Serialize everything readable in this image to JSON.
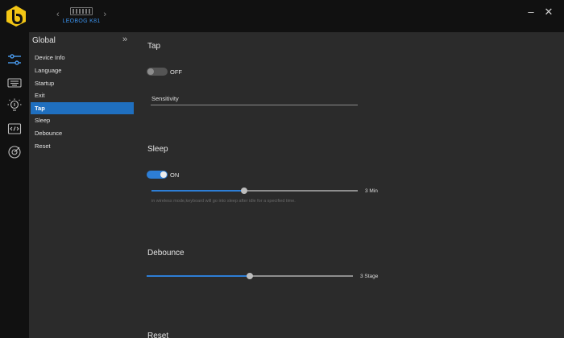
{
  "app": {
    "device_name": "LEOBOG K81",
    "colors": {
      "accent": "#2d7ed6",
      "logo": "#f3c614",
      "active_nav": "#1f6fbf"
    }
  },
  "window": {
    "minimize_label": "–",
    "close_label": "✕"
  },
  "rail": {
    "icons": [
      "sliders-icon",
      "keyboard-icon",
      "lightbulb-icon",
      "macro-icon",
      "target-icon"
    ]
  },
  "sidebar": {
    "title": "Global",
    "collapse_label": "»",
    "items": [
      {
        "label": "Device Info"
      },
      {
        "label": "Language"
      },
      {
        "label": "Startup"
      },
      {
        "label": "Exit"
      },
      {
        "label": "Tap",
        "active": true
      },
      {
        "label": "Sleep"
      },
      {
        "label": "Debounce"
      },
      {
        "label": "Reset"
      }
    ]
  },
  "tap": {
    "title": "Tap",
    "toggle_on": false,
    "toggle_label": "OFF",
    "sensitivity_label": "Sensitivity"
  },
  "sleep": {
    "title": "Sleep",
    "toggle_on": true,
    "toggle_label": "ON",
    "value_fraction": 0.45,
    "value_label": "3 Min",
    "hint": "in wireless mode,keyboard will go into sleep after idle for a specified time."
  },
  "debounce": {
    "title": "Debounce",
    "value_fraction": 0.5,
    "value_label": "3 Stage"
  },
  "reset": {
    "title": "Reset"
  }
}
